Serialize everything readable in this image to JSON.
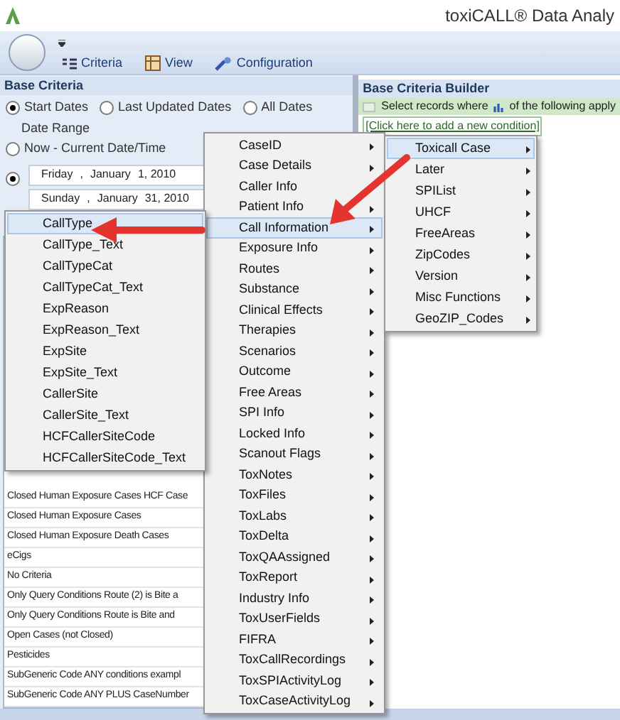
{
  "window": {
    "title": "toxiCALL® Data Analy"
  },
  "ribbon": {
    "tabs": [
      {
        "label": "Criteria",
        "kind": "criteria"
      },
      {
        "label": "View",
        "kind": "view"
      },
      {
        "label": "Configuration",
        "kind": "configuration"
      }
    ]
  },
  "base_criteria": {
    "title": "Base Criteria",
    "date_modes": [
      {
        "label": "Start Dates",
        "selected": true
      },
      {
        "label": "Last Updated Dates",
        "selected": false
      },
      {
        "label": "All Dates",
        "selected": false
      }
    ],
    "date_range_label": "Date Range",
    "now_option": {
      "label": "Now - Current Date/Time",
      "selected": false
    },
    "custom_option": {
      "selected": true
    },
    "date_fields": [
      {
        "parts": [
          "Friday",
          ",",
          "January",
          "1, 2010"
        ]
      },
      {
        "parts": [
          "Sunday",
          ",",
          "January",
          "31, 2010"
        ]
      }
    ],
    "saved_queries": [
      "Closed Human Exposure Cases HCF Case",
      "Closed Human Exposure Cases",
      "Closed Human Exposure Death Cases",
      "eCigs",
      "No Criteria",
      "Only Query Conditions Route (2) is Bite a",
      "Only Query Conditions Route is Bite and",
      "Open Cases (not Closed)",
      "Pesticides",
      "SubGeneric Code ANY conditions exampl",
      "SubGeneric Code ANY PLUS CaseNumber"
    ]
  },
  "builder": {
    "title": "Base Criteria Builder",
    "condition_prefix": "Select records where",
    "condition_suffix": "of the following apply",
    "add_link": "[Click here to add a new condition]"
  },
  "main_menu": [
    {
      "label": "CaseID",
      "selected": false
    },
    {
      "label": "Case Details",
      "selected": false
    },
    {
      "label": "Caller Info",
      "selected": false
    },
    {
      "label": "Patient Info",
      "selected": false
    },
    {
      "label": "Call Information",
      "selected": true
    },
    {
      "label": "Exposure Info",
      "selected": false
    },
    {
      "label": "Routes",
      "selected": false
    },
    {
      "label": "Substance",
      "selected": false
    },
    {
      "label": "Clinical Effects",
      "selected": false
    },
    {
      "label": "Therapies",
      "selected": false
    },
    {
      "label": "Scenarios",
      "selected": false
    },
    {
      "label": "Outcome",
      "selected": false
    },
    {
      "label": "Free Areas",
      "selected": false
    },
    {
      "label": "SPI Info",
      "selected": false
    },
    {
      "label": "Locked Info",
      "selected": false
    },
    {
      "label": "Scanout Flags",
      "selected": false
    },
    {
      "label": "ToxNotes",
      "selected": false
    },
    {
      "label": "ToxFiles",
      "selected": false
    },
    {
      "label": "ToxLabs",
      "selected": false
    },
    {
      "label": "ToxDelta",
      "selected": false
    },
    {
      "label": "ToxQAAssigned",
      "selected": false
    },
    {
      "label": "ToxReport",
      "selected": false
    },
    {
      "label": "Industry Info",
      "selected": false
    },
    {
      "label": "ToxUserFields",
      "selected": false
    },
    {
      "label": "FIFRA",
      "selected": false
    },
    {
      "label": "ToxCallRecordings",
      "selected": false
    },
    {
      "label": "ToxSPIActivityLog",
      "selected": false
    },
    {
      "label": "ToxCaseActivityLog",
      "selected": false
    }
  ],
  "field_menu": [
    {
      "label": "CallType",
      "selected": true
    },
    {
      "label": "CallType_Text",
      "selected": false
    },
    {
      "label": "CallTypeCat",
      "selected": false
    },
    {
      "label": "CallTypeCat_Text",
      "selected": false
    },
    {
      "label": "ExpReason",
      "selected": false
    },
    {
      "label": "ExpReason_Text",
      "selected": false
    },
    {
      "label": "ExpSite",
      "selected": false
    },
    {
      "label": "ExpSite_Text",
      "selected": false
    },
    {
      "label": "CallerSite",
      "selected": false
    },
    {
      "label": "CallerSite_Text",
      "selected": false
    },
    {
      "label": "HCFCallerSiteCode",
      "selected": false
    },
    {
      "label": "HCFCallerSiteCode_Text",
      "selected": false
    }
  ],
  "category_menu": [
    {
      "label": "Toxicall Case",
      "selected": true
    },
    {
      "label": "Later",
      "selected": false
    },
    {
      "label": "SPIList",
      "selected": false
    },
    {
      "label": "UHCF",
      "selected": false
    },
    {
      "label": "FreeAreas",
      "selected": false
    },
    {
      "label": "ZipCodes",
      "selected": false
    },
    {
      "label": "Version",
      "selected": false
    },
    {
      "label": "Misc Functions",
      "selected": false
    },
    {
      "label": "GeoZIP_Codes",
      "selected": false
    }
  ]
}
